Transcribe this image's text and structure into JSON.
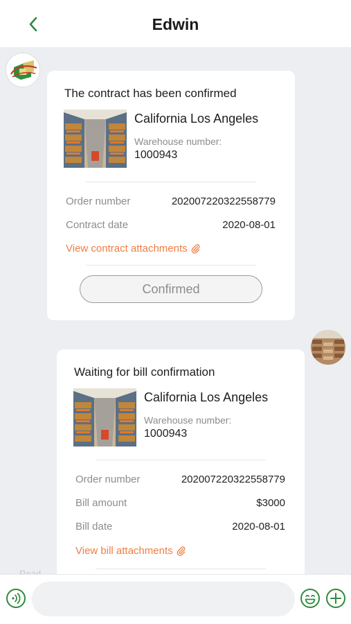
{
  "header": {
    "title": "Edwin"
  },
  "messages": [
    {
      "title": "The contract has been confirmed",
      "location": "California Los Angeles",
      "warehouse_label": "Warehouse number:",
      "warehouse_number": "1000943",
      "rows": [
        {
          "label": "Order number",
          "value": "202007220322558779"
        },
        {
          "label": "Contract date",
          "value": "2020-08-01"
        }
      ],
      "attachment_link": "View contract attachments",
      "button_label": "Confirmed"
    },
    {
      "title": "Waiting for bill confirmation",
      "location": "California Los Angeles",
      "warehouse_label": "Warehouse number:",
      "warehouse_number": "1000943",
      "rows": [
        {
          "label": "Order number",
          "value": "202007220322558779"
        },
        {
          "label": "Bill amount",
          "value": "$3000"
        },
        {
          "label": "Bill date",
          "value": "2020-08-01"
        }
      ],
      "attachment_link": "View bill attachments"
    }
  ],
  "read_hint": "Read",
  "input": {
    "value": "",
    "placeholder": ""
  },
  "icons": {
    "back": "chevron-left-icon",
    "voice": "voice-icon",
    "emoji": "emoji-icon",
    "plus": "plus-icon",
    "attachment": "paperclip-icon"
  },
  "colors": {
    "accent": "#2e8b3e",
    "link": "#ef7d42",
    "background": "#eceef1"
  }
}
